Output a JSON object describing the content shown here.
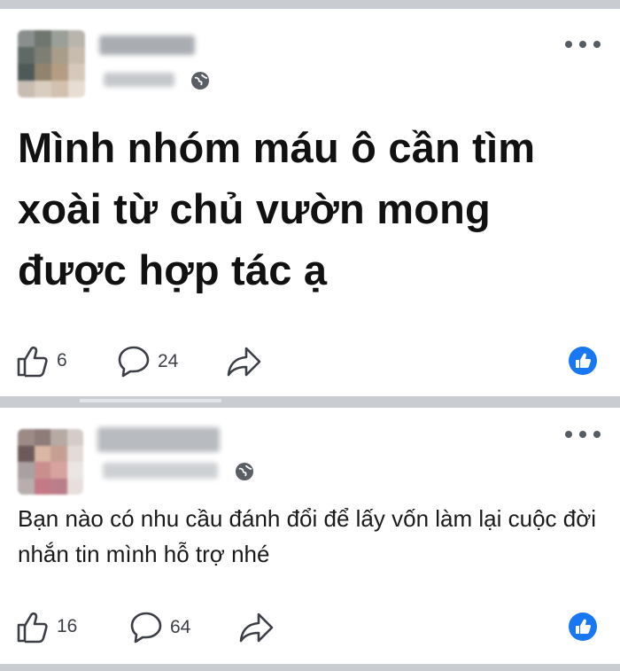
{
  "posts": [
    {
      "text": "Mình nhóm máu ô cần tìm xoài từ chủ vườn mong được hợp tác ạ",
      "likes": "6",
      "comments": "24"
    },
    {
      "text": "Bạn nào có nhu cầu đánh đổi để lấy vốn làm lại cuộc đời nhắn tin mình hỗ trợ nhé",
      "likes": "16",
      "comments": "64"
    }
  ],
  "icons": {
    "more": "more-options-icon",
    "privacy": "globe-icon",
    "like": "thumbs-up-icon",
    "comment": "comment-bubble-icon",
    "share": "share-arrow-icon",
    "reaction": "like-reaction-icon"
  },
  "colors": {
    "background": "#c9ccd1",
    "card": "#ffffff",
    "accent": "#1877f2",
    "text": "#111111"
  }
}
